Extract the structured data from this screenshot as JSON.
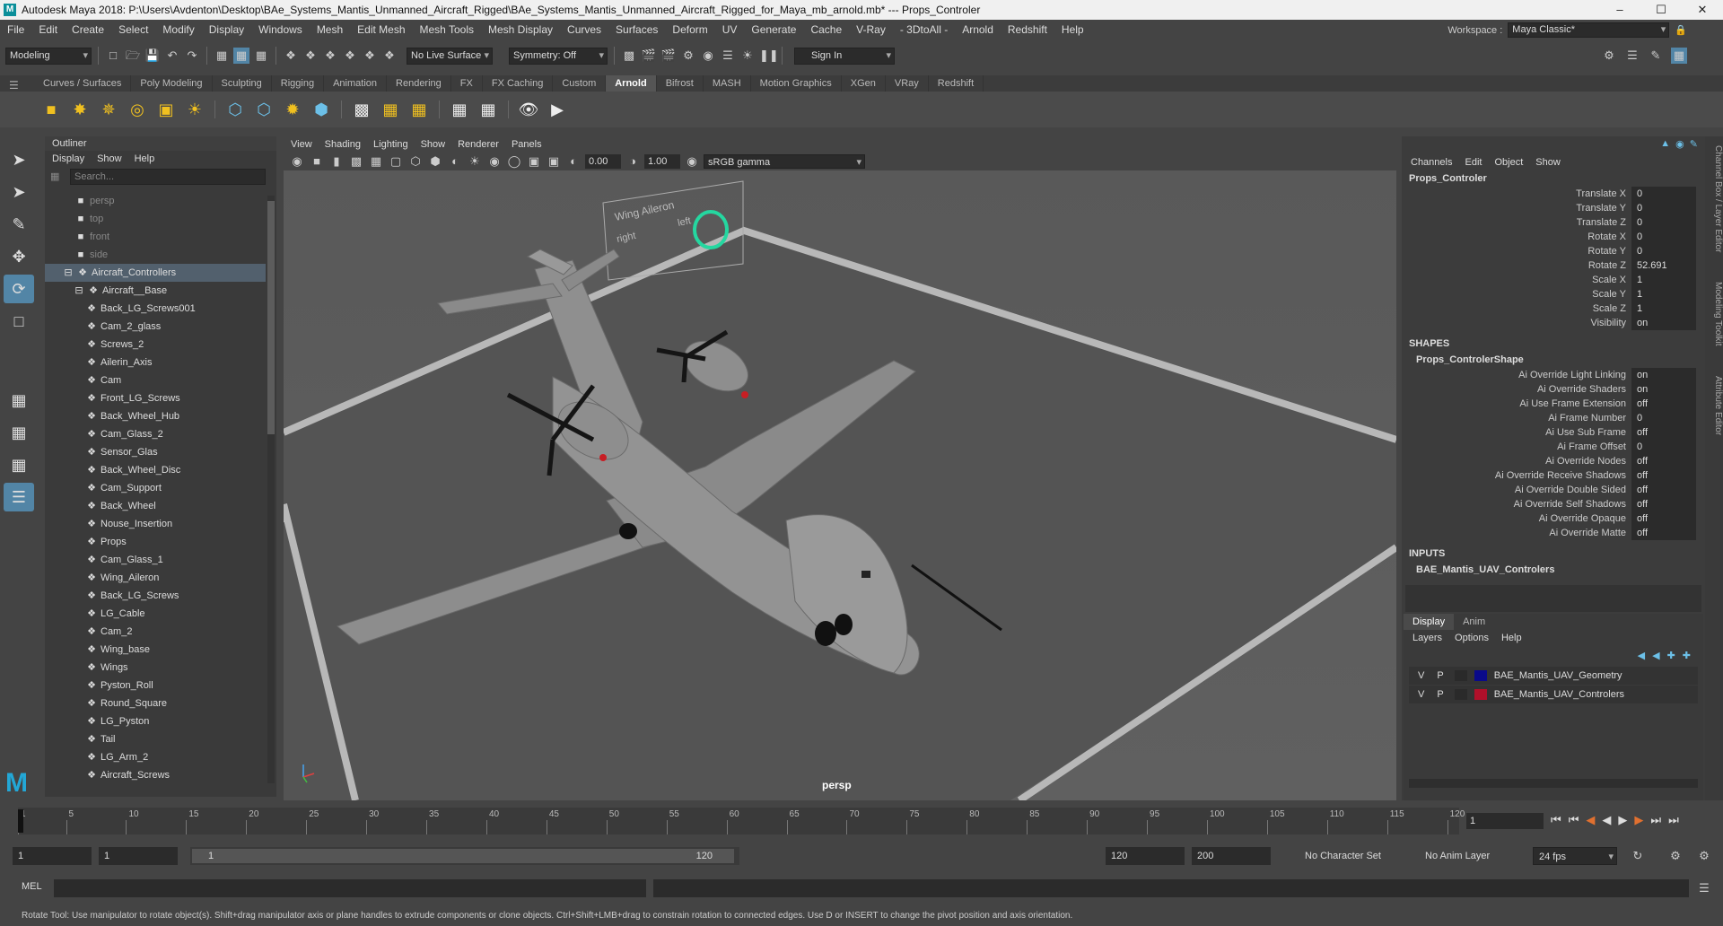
{
  "window": {
    "title": "Autodesk Maya 2018: P:\\Users\\Avdenton\\Desktop\\BAe_Systems_Mantis_Unmanned_Aircraft_Rigged\\BAe_Systems_Mantis_Unmanned_Aircraft_Rigged_for_Maya_mb_arnold.mb*  ---  Props_Controler",
    "minimize": "–",
    "maximize": "☐",
    "close": "✕"
  },
  "menubar": {
    "items": [
      "File",
      "Edit",
      "Create",
      "Select",
      "Modify",
      "Display",
      "Windows",
      "Mesh",
      "Edit Mesh",
      "Mesh Tools",
      "Mesh Display",
      "Curves",
      "Surfaces",
      "Deform",
      "UV",
      "Generate",
      "Cache",
      "V-Ray",
      "- 3DtoAll -",
      "Arnold",
      "Redshift",
      "Help"
    ],
    "workspace_label": "Workspace :",
    "workspace_value": "Maya Classic*"
  },
  "statusline": {
    "mode": "Modeling",
    "live_surface": "No Live Surface",
    "symmetry": "Symmetry: Off",
    "sign_in": "Sign In"
  },
  "shelf": {
    "tabs": [
      "Curves / Surfaces",
      "Poly Modeling",
      "Sculpting",
      "Rigging",
      "Animation",
      "Rendering",
      "FX",
      "FX Caching",
      "Custom",
      "Arnold",
      "Bifrost",
      "MASH",
      "Motion Graphics",
      "XGen",
      "VRay",
      "Redshift"
    ],
    "active": "Arnold"
  },
  "outliner": {
    "title": "Outliner",
    "menus": [
      "Display",
      "Show",
      "Help"
    ],
    "search_placeholder": "Search...",
    "cameras": [
      "persp",
      "top",
      "front",
      "side"
    ],
    "group": "Aircraft_Controllers",
    "subgroup": "Aircraft__Base",
    "items": [
      "Back_LG_Screws001",
      "Cam_2_glass",
      "Screws_2",
      "Ailerin_Axis",
      "Cam",
      "Front_LG_Screws",
      "Back_Wheel_Hub",
      "Cam_Glass_2",
      "Sensor_Glas",
      "Back_Wheel_Disc",
      "Cam_Support",
      "Back_Wheel",
      "Nouse_Insertion",
      "Props",
      "Cam_Glass_1",
      "Wing_Aileron",
      "Back_LG_Screws",
      "LG_Cable",
      "Cam_2",
      "Wing_base",
      "Wings",
      "Pyston_Roll",
      "Round_Square",
      "LG_Pyston",
      "Tail",
      "LG_Arm_2",
      "Aircraft_Screws"
    ]
  },
  "viewport": {
    "menus": [
      "View",
      "Shading",
      "Lighting",
      "Show",
      "Renderer",
      "Panels"
    ],
    "exposure": "0.00",
    "gamma": "1.00",
    "colorspace": "sRGB gamma",
    "camera_label": "persp",
    "control_text_1": "Wing Aileron",
    "control_text_2": "right",
    "control_text_3": "left"
  },
  "channelbox": {
    "menus": [
      "Channels",
      "Edit",
      "Object",
      "Show"
    ],
    "object": "Props_Controler",
    "attributes": [
      {
        "label": "Translate X",
        "value": "0"
      },
      {
        "label": "Translate Y",
        "value": "0"
      },
      {
        "label": "Translate Z",
        "value": "0"
      },
      {
        "label": "Rotate X",
        "value": "0"
      },
      {
        "label": "Rotate Y",
        "value": "0"
      },
      {
        "label": "Rotate Z",
        "value": "52.691"
      },
      {
        "label": "Scale X",
        "value": "1"
      },
      {
        "label": "Scale Y",
        "value": "1"
      },
      {
        "label": "Scale Z",
        "value": "1"
      },
      {
        "label": "Visibility",
        "value": "on"
      }
    ],
    "shapes_header": "SHAPES",
    "shape_name": "Props_ControlerShape",
    "shape_attrs": [
      {
        "label": "Ai Override Light Linking",
        "value": "on"
      },
      {
        "label": "Ai Override Shaders",
        "value": "on"
      },
      {
        "label": "Ai Use Frame Extension",
        "value": "off"
      },
      {
        "label": "Ai Frame Number",
        "value": "0"
      },
      {
        "label": "Ai Use Sub Frame",
        "value": "off"
      },
      {
        "label": "Ai Frame Offset",
        "value": "0"
      },
      {
        "label": "Ai Override Nodes",
        "value": "off"
      },
      {
        "label": "Ai Override Receive Shadows",
        "value": "off"
      },
      {
        "label": "Ai Override Double Sided",
        "value": "off"
      },
      {
        "label": "Ai Override Self Shadows",
        "value": "off"
      },
      {
        "label": "Ai Override Opaque",
        "value": "off"
      },
      {
        "label": "Ai Override Matte",
        "value": "off"
      }
    ],
    "inputs_header": "INPUTS",
    "input_name": "BAE_Mantis_UAV_Controlers",
    "side_tabs": [
      "Channel Box / Layer Editor",
      "Modeling Toolkit",
      "Attribute Editor"
    ]
  },
  "layers": {
    "tabs": [
      "Display",
      "Anim"
    ],
    "menus": [
      "Layers",
      "Options",
      "Help"
    ],
    "rows": [
      {
        "v": "V",
        "p": "P",
        "color": "#0a0a8a",
        "name": "BAE_Mantis_UAV_Geometry"
      },
      {
        "v": "V",
        "p": "P",
        "color": "#b0102a",
        "name": "BAE_Mantis_UAV_Controlers"
      }
    ]
  },
  "timeline": {
    "ticks": [
      "1",
      "5",
      "10",
      "15",
      "20",
      "25",
      "30",
      "35",
      "40",
      "45",
      "50",
      "55",
      "60",
      "65",
      "70",
      "75",
      "80",
      "85",
      "90",
      "95",
      "100",
      "105",
      "110",
      "115",
      "120"
    ],
    "current_frame": "1"
  },
  "range": {
    "start": "1",
    "start2": "1",
    "slider_start": "1",
    "slider_end": "120",
    "end": "120",
    "end2": "200",
    "character_set": "No Character Set",
    "anim_layer": "No Anim Layer",
    "fps": "24 fps"
  },
  "mel": {
    "label": "MEL"
  },
  "help_line": "Rotate Tool: Use manipulator to rotate object(s). Shift+drag manipulator axis or plane handles to extrude components or clone objects. Ctrl+Shift+LMB+drag to constrain rotation to connected edges. Use D or INSERT to change the pivot position and axis orientation."
}
